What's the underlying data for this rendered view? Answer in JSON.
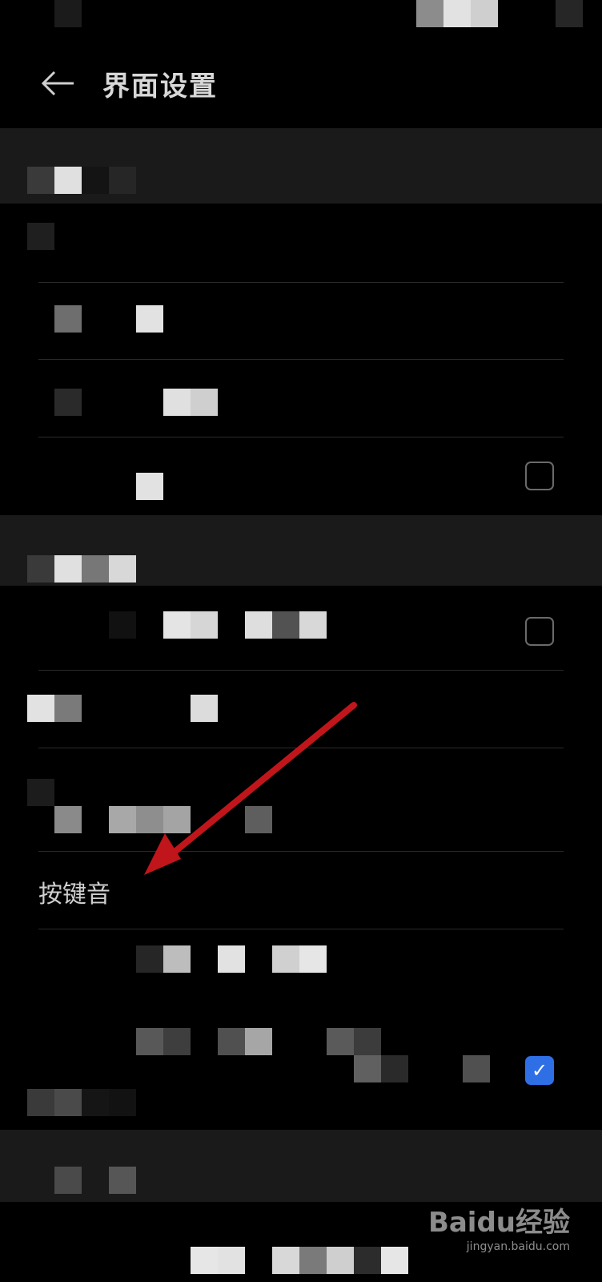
{
  "header": {
    "title": "界面设置"
  },
  "rows": {
    "key_tone": {
      "label": "按键音"
    }
  },
  "watermark": {
    "logo": "Baidu经验",
    "url": "jingyan.baidu.com"
  },
  "colors": {
    "background": "#000000",
    "section": "#1a1a1a",
    "accent": "#2f6fe6",
    "arrow": "#c0161b"
  },
  "icons": {
    "back": "back-arrow-icon",
    "checkbox": "checkbox-icon"
  }
}
